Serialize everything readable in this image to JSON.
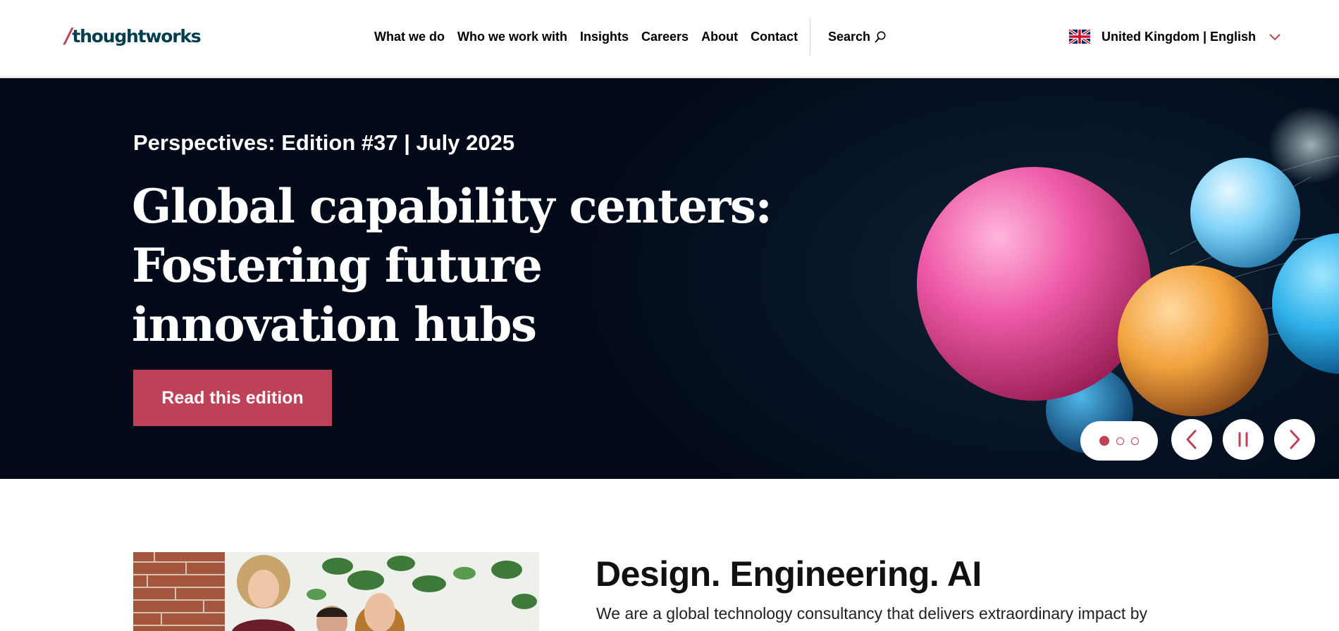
{
  "header": {
    "logo": {
      "slash": "/",
      "text": "thoughtworks"
    },
    "nav": [
      "What we do",
      "Who we work with",
      "Insights",
      "Careers",
      "About",
      "Contact"
    ],
    "search_label": "Search",
    "locale": {
      "label": "United Kingdom | English",
      "flag_icon": "uk-flag-icon"
    }
  },
  "hero": {
    "eyebrow": "Perspectives: Edition #37 | July 2025",
    "title": "Global capability centers: Fostering future innovation hubs",
    "cta_label": "Read this edition",
    "carousel": {
      "slide_count": 3,
      "active_slide": 1
    },
    "icons": [
      "chevron-left-icon",
      "pause-icon",
      "chevron-right-icon"
    ]
  },
  "intro": {
    "title": "Design. Engineering. AI",
    "body": "We are a global technology consultancy that delivers extraordinary impact by"
  },
  "colors": {
    "brand": "#bd4257",
    "logo_text": "#003d4f",
    "hero_bg": "#030a1a"
  }
}
